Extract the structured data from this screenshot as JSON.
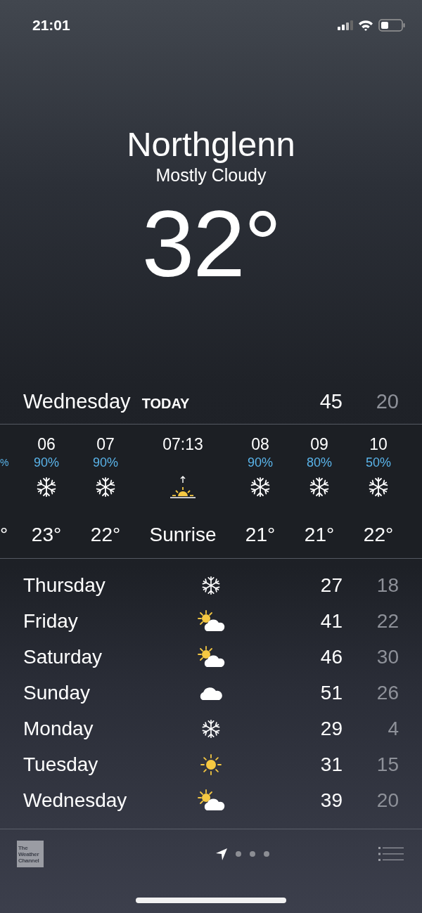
{
  "status_bar": {
    "time": "21:01"
  },
  "header": {
    "city": "Northglenn",
    "condition": "Mostly Cloudy",
    "temperature": "32°"
  },
  "today": {
    "day": "Wednesday",
    "label": "TODAY",
    "high": "45",
    "low": "20"
  },
  "hourly": [
    {
      "kind": "partial",
      "pop": "%",
      "temp": "°"
    },
    {
      "kind": "snow",
      "time": "06",
      "pop": "90%",
      "temp": "23°"
    },
    {
      "kind": "snow",
      "time": "07",
      "pop": "90%",
      "temp": "22°"
    },
    {
      "kind": "sunrise",
      "time": "07:13",
      "temp": "Sunrise"
    },
    {
      "kind": "snow",
      "time": "08",
      "pop": "90%",
      "temp": "21°"
    },
    {
      "kind": "snow",
      "time": "09",
      "pop": "80%",
      "temp": "21°"
    },
    {
      "kind": "snow",
      "time": "10",
      "pop": "50%",
      "temp": "22°"
    }
  ],
  "daily": [
    {
      "day": "Thursday",
      "kind": "snow",
      "high": "27",
      "low": "18"
    },
    {
      "day": "Friday",
      "kind": "sun-cloud",
      "high": "41",
      "low": "22"
    },
    {
      "day": "Saturday",
      "kind": "sun-cloud",
      "high": "46",
      "low": "30"
    },
    {
      "day": "Sunday",
      "kind": "cloud",
      "high": "51",
      "low": "26"
    },
    {
      "day": "Monday",
      "kind": "snow",
      "high": "29",
      "low": "4"
    },
    {
      "day": "Tuesday",
      "kind": "sun",
      "high": "31",
      "low": "15"
    },
    {
      "day": "Wednesday",
      "kind": "sun-cloud",
      "high": "39",
      "low": "20"
    }
  ],
  "bottom_bar": {
    "logo_lines": [
      "The",
      "Weather",
      "Channel"
    ],
    "pages": [
      {
        "kind": "location",
        "selected": true
      },
      {
        "kind": "dot",
        "selected": false
      },
      {
        "kind": "dot",
        "selected": false
      },
      {
        "kind": "dot",
        "selected": false
      }
    ]
  }
}
